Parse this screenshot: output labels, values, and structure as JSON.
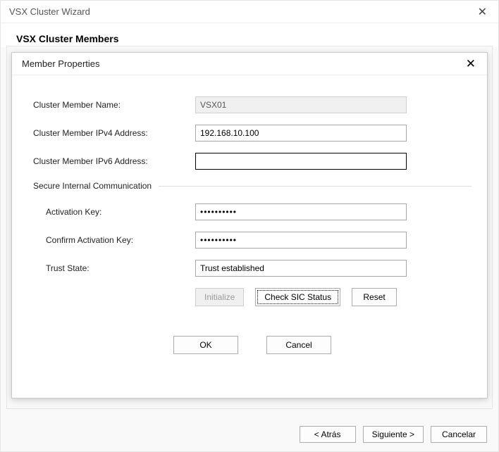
{
  "outer": {
    "title": "VSX Cluster Wizard",
    "header_title": "VSX Cluster Members",
    "buttons": {
      "back": "< Atrás",
      "next": "Siguiente >",
      "cancel": "Cancelar"
    }
  },
  "modal": {
    "title": "Member Properties",
    "labels": {
      "name": "Cluster Member Name:",
      "ipv4": "Cluster Member IPv4 Address:",
      "ipv6": "Cluster Member IPv6 Address:",
      "sic_section": "Secure Internal Communication",
      "activation_key": "Activation Key:",
      "confirm_key": "Confirm Activation Key:",
      "trust_state": "Trust State:"
    },
    "values": {
      "name": "VSX01",
      "ipv4": "192.168.10.100",
      "ipv6": "",
      "activation_key": "••••••••••",
      "confirm_key": "••••••••••",
      "trust_state": "Trust established"
    },
    "buttons": {
      "initialize": "Initialize",
      "check_sic": "Check SIC Status",
      "reset": "Reset",
      "ok": "OK",
      "cancel": "Cancel"
    }
  }
}
